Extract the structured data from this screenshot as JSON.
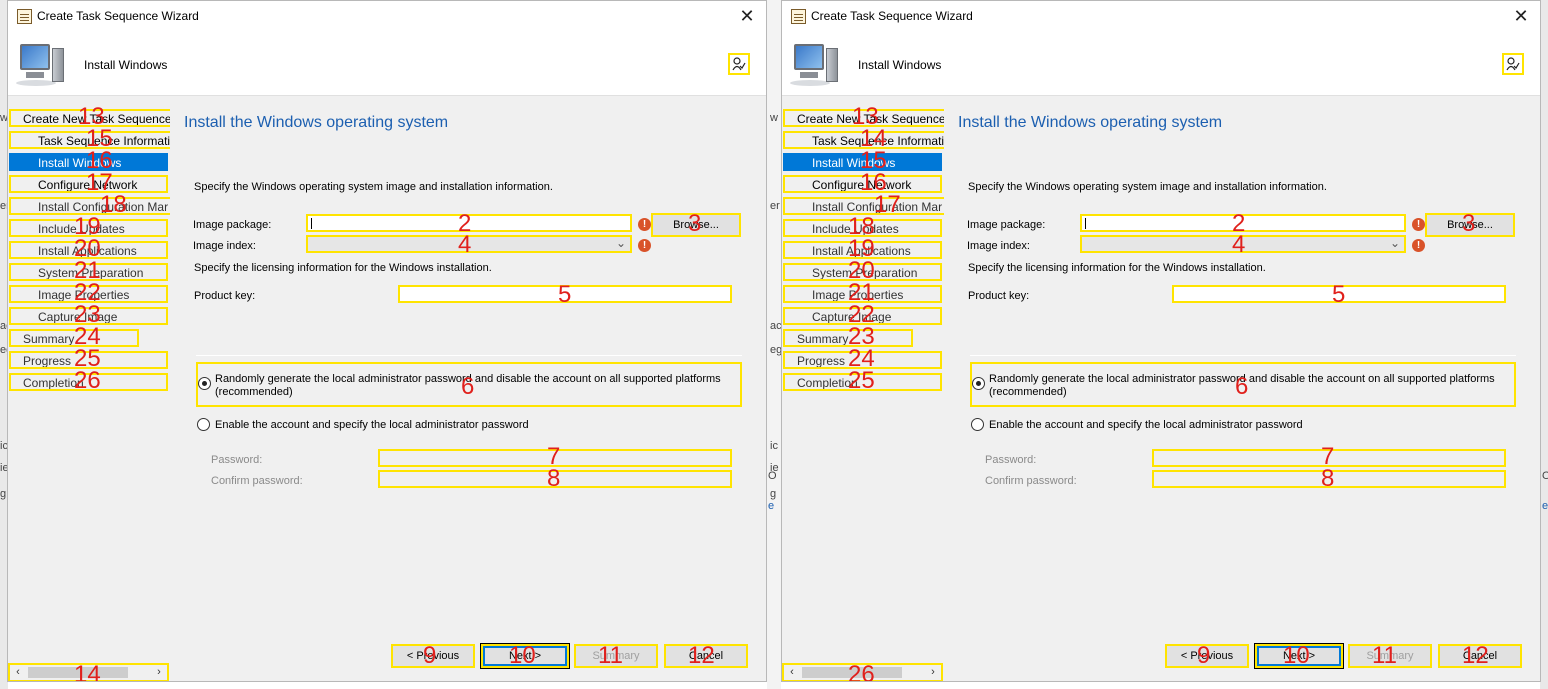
{
  "window_title": "Create Task Sequence Wizard",
  "page_header": "Install Windows",
  "content": {
    "title": "Install the Windows operating system",
    "intro": "Specify the Windows operating system image and installation information.",
    "image_package_label": "Image package:",
    "browse_label": "Browse...",
    "image_index_label": "Image index:",
    "licensing_text": "Specify the licensing information for the Windows installation.",
    "product_key_label": "Product key:",
    "option_random_line1": "Randomly generate the local administrator password and disable the account on all supported platforms",
    "option_random_line2": "(recommended)",
    "option_enable": "Enable the account and specify the local administrator password",
    "password_label": "Password:",
    "confirm_password_label": "Confirm password:",
    "warning_glyph": "!"
  },
  "buttons": {
    "previous": "< Previous",
    "next": "Next >",
    "summary": "Summary",
    "cancel": "Cancel"
  },
  "nav_items": [
    "Create New Task Sequence",
    "Task Sequence Informatic",
    "Install Windows",
    "Configure Network",
    "Install Configuration Mar",
    "Include Updates",
    "Install Applications",
    "System Preparation",
    "Image Properties",
    "Capture Image",
    "Summary",
    "Progress",
    "Completion"
  ],
  "markers_common": {
    "image_package": "2",
    "browse": "3",
    "image_index": "4",
    "product_key": "5",
    "option_random": "6",
    "password": "7",
    "confirm": "8",
    "previous": "9",
    "next": "10",
    "summary": "11",
    "cancel": "12"
  },
  "markers_left": {
    "nav": [
      "13",
      "15",
      "16",
      "17",
      "18",
      "19",
      "20",
      "21",
      "22",
      "23",
      "24",
      "25",
      "26"
    ],
    "scrollbar": "14"
  },
  "markers_right": {
    "nav": [
      "13",
      "14",
      "15",
      "16",
      "17",
      "18",
      "19",
      "20",
      "21",
      "22",
      "23",
      "24",
      "25"
    ],
    "scrollbar": "26"
  },
  "background_fragments": [
    "w",
    "er",
    "ac",
    "eg",
    "ic",
    "ie",
    "g",
    "w",
    "er",
    "ac",
    "eg",
    "ic",
    "ie",
    "g",
    "O",
    "O",
    "e",
    "e"
  ],
  "icons": {
    "close": "✕",
    "scroll_left": "‹",
    "scroll_right": "›",
    "chevron": "⌄"
  },
  "colors": {
    "accent": "#0078d7",
    "title_blue": "#1c5fb0",
    "annotation_box": "#ffe400",
    "annotation_number": "#e0201c",
    "warning": "#d9532a"
  }
}
